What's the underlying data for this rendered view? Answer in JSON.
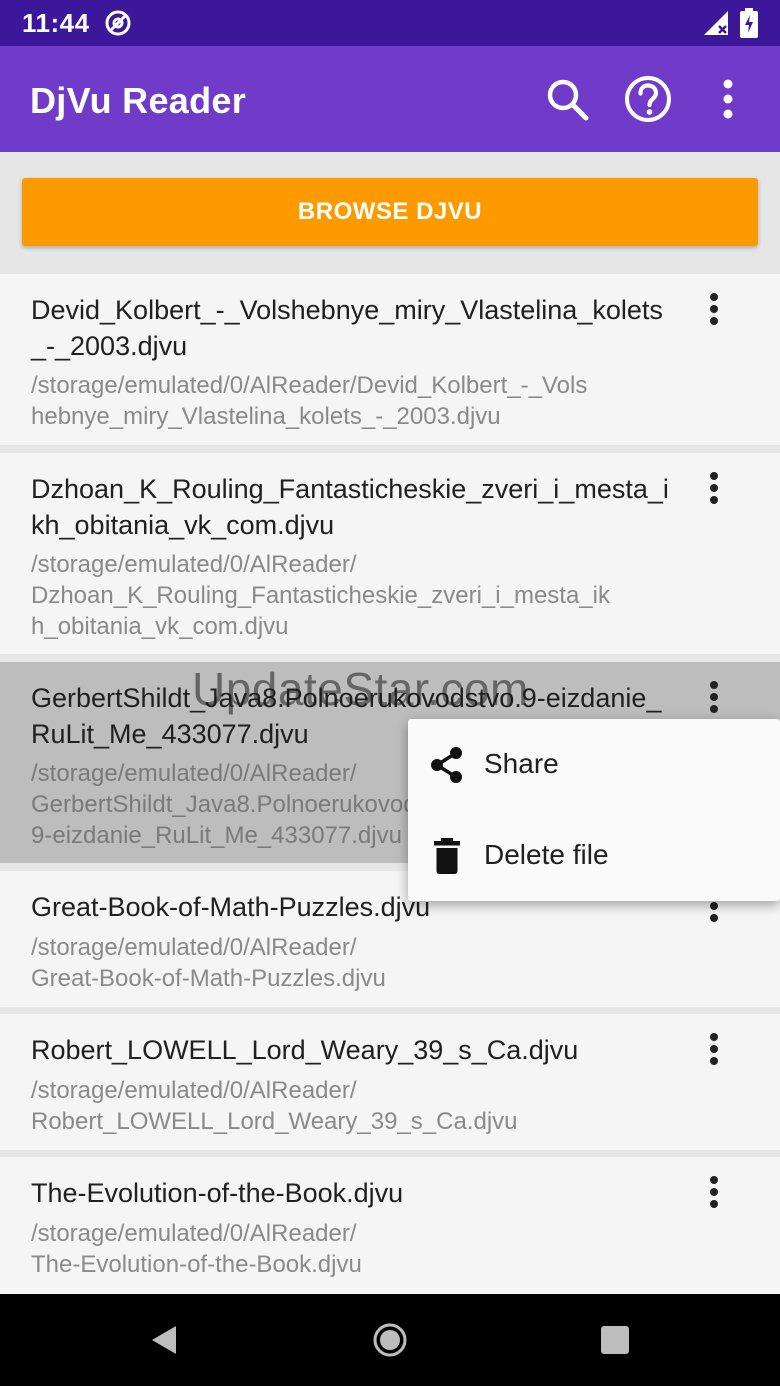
{
  "status_bar": {
    "time": "11:44"
  },
  "app_bar": {
    "title": "DjVu Reader",
    "icons": [
      "search-icon",
      "help-icon",
      "more-vert-icon"
    ]
  },
  "browse_button": {
    "label": "BROWSE DJVU"
  },
  "files": [
    {
      "name": "Devid_Kolbert_-_Volshebnye_miry_Vlastelina_kolets_-_2003.djvu",
      "path_lines": [
        "/storage/emulated/0/AlReader/Devid_Kolbert_-_Vols",
        "hebnye_miry_Vlastelina_kolets_-_2003.djvu"
      ]
    },
    {
      "name": "Dzhoan_K_Rouling_Fantasticheskie_zveri_i_mesta_ikh_obitania_vk_com.djvu",
      "path_lines": [
        "/storage/emulated/0/AlReader/",
        "Dzhoan_K_Rouling_Fantasticheskie_zveri_i_mesta_ik",
        "h_obitania_vk_com.djvu"
      ]
    },
    {
      "name": "GerbertShildt_Java8.Polnoerukovodstvo.9-eizdanie_RuLit_Me_433077.djvu",
      "path_lines": [
        "/storage/emulated/0/AlReader/",
        "GerbertShildt_Java8.Polnoerukovodstvo.",
        "9-eizdanie_RuLit_Me_433077.djvu"
      ]
    },
    {
      "name": "Great-Book-of-Math-Puzzles.djvu",
      "path_lines": [
        "/storage/emulated/0/AlReader/",
        "Great-Book-of-Math-Puzzles.djvu"
      ]
    },
    {
      "name": "Robert_LOWELL_Lord_Weary_39_s_Ca.djvu",
      "path_lines": [
        "/storage/emulated/0/AlReader/",
        "Robert_LOWELL_Lord_Weary_39_s_Ca.djvu"
      ]
    },
    {
      "name": "The-Evolution-of-the-Book.djvu",
      "path_lines": [
        "/storage/emulated/0/AlReader/",
        "The-Evolution-of-the-Book.djvu"
      ]
    }
  ],
  "context_menu": {
    "items": [
      {
        "label": "Share",
        "icon": "share-icon"
      },
      {
        "label": "Delete file",
        "icon": "delete-icon"
      }
    ]
  },
  "watermark": "UpdateStar.com",
  "colors": {
    "status_bar": "#3d179a",
    "app_bar": "#6f3bc8",
    "browse_button": "#fd9a00",
    "list_background": "#f5f5f5",
    "selected_row": "#bdbdbd"
  }
}
